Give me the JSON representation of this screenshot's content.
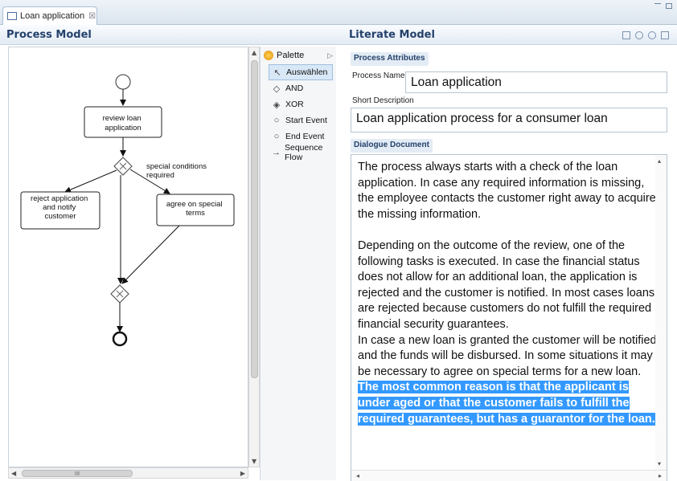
{
  "editor": {
    "tab_title": "Loan application",
    "tab_close": "☒"
  },
  "process_model": {
    "title": "Process Model",
    "diagram": {
      "tasks": {
        "review": "review loan\napplication",
        "reject": "reject application\nand notify\ncustomer",
        "agree": "agree on special\nterms"
      },
      "condition_label": "special conditions\nrequired"
    },
    "scroll_thumb_glyph": "III"
  },
  "palette": {
    "title": "Palette",
    "items": [
      {
        "label": "Auswählen",
        "icon": "pointer-icon",
        "selected": true
      },
      {
        "label": "AND",
        "icon": "and-gateway-icon",
        "selected": false
      },
      {
        "label": "XOR",
        "icon": "xor-gateway-icon",
        "selected": false
      },
      {
        "label": "Start Event",
        "icon": "start-event-icon",
        "selected": false
      },
      {
        "label": "End Event",
        "icon": "end-event-icon",
        "selected": false
      },
      {
        "label": "Sequence Flow",
        "icon": "sequence-flow-icon",
        "selected": false
      }
    ]
  },
  "literate_model": {
    "title": "Literate Model",
    "process_attributes_label": "Process Attributes",
    "process_name_label": "Process Name",
    "process_name_value": "Loan application",
    "short_description_label": "Short Description",
    "short_description_value": "Loan application process for a consumer loan",
    "dialogue_document_label": "Dialogue Document",
    "dialogue": {
      "p1": "The process always starts with a check of the loan application. In case any required information is missing, the employee contacts the customer right away to acquire the missing information.",
      "p2": "Depending on the outcome of the review, one of the following tasks is executed. In case the financial status does not allow for an additional loan, the application is rejected and the customer is notified. In most cases loans are rejected because customers do not fulfill the required financial security guarantees.",
      "p3_plain": "In case a new loan is granted the customer will be notified and the funds will be disbursed. In some situations it may be necessary to agree on special terms for a new loan. ",
      "p3_selected": "The most common reason is that the applicant is under aged or that the customer fails to fulfill the required guarantees, but has a guarantor for the loan."
    }
  },
  "colors": {
    "header_text": "#24416b",
    "selection": "#3399ff"
  }
}
